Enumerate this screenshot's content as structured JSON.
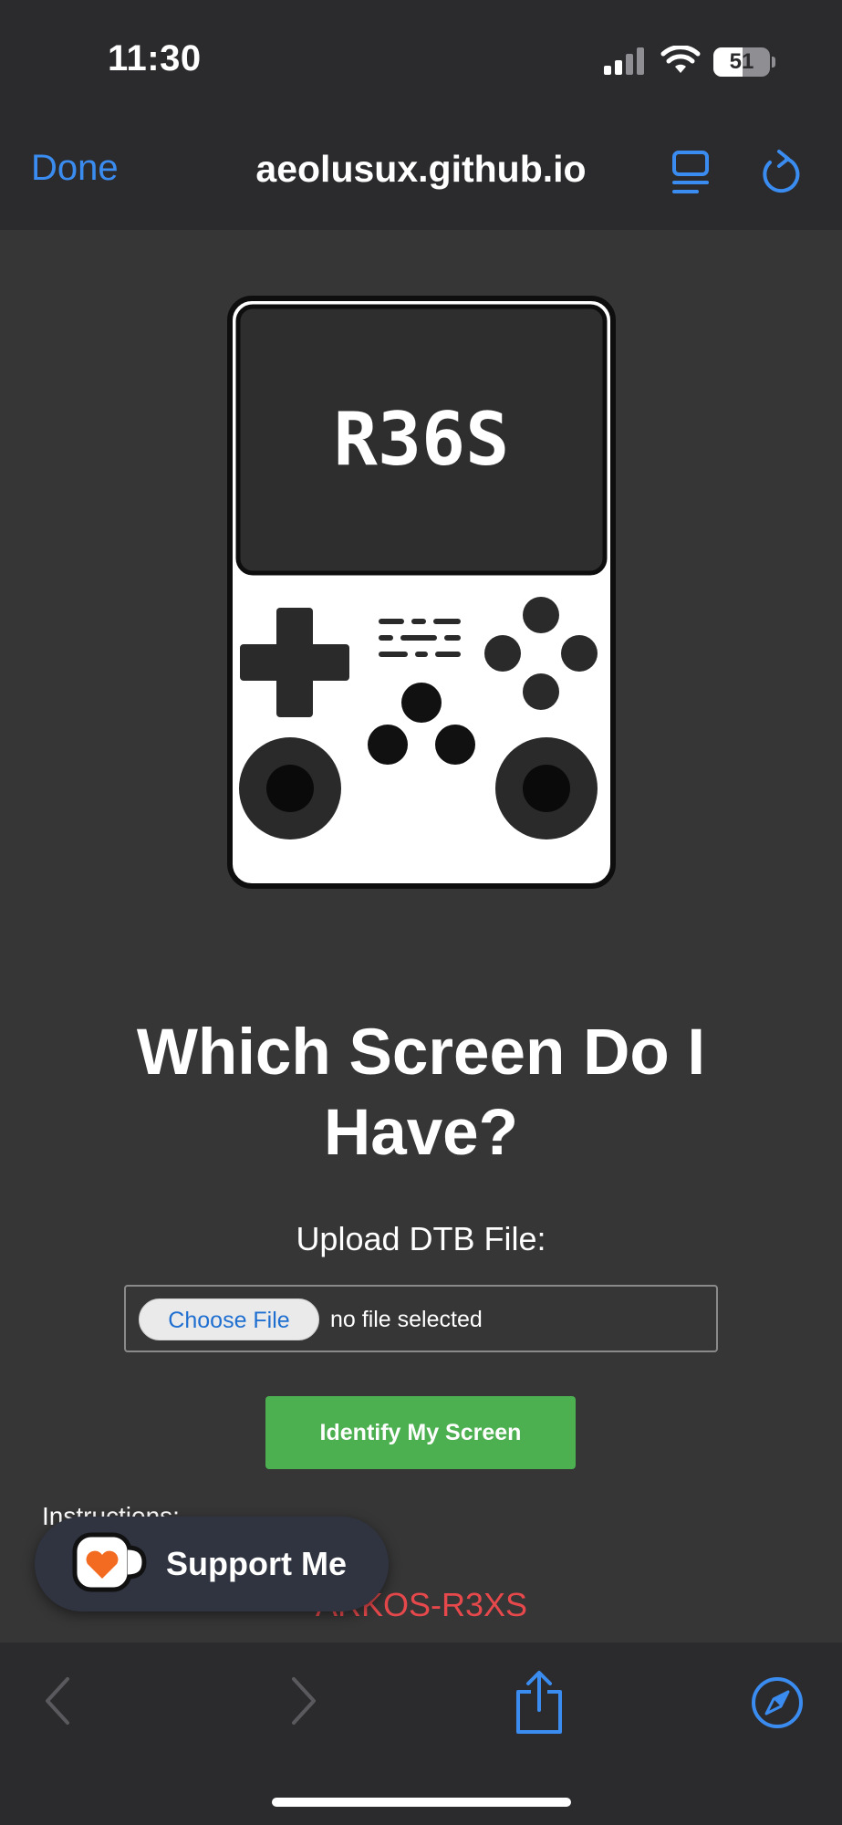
{
  "status_bar": {
    "time": "11:30",
    "battery_level": "51"
  },
  "browser": {
    "done_label": "Done",
    "url": "aeolusux.github.io"
  },
  "device_logo_text": "R36S",
  "page": {
    "heading": "Which Screen Do I Have?",
    "upload_label": "Upload DTB File:",
    "choose_file_label": "Choose File",
    "no_file_text": "no file selected",
    "identify_button_label": "Identify My Screen",
    "instructions_label": "Instructions:",
    "partial_red_text": "ARKOS-R3XS"
  },
  "support_widget": {
    "label": "Support Me"
  },
  "colors": {
    "accent_blue": "#3b8cf0",
    "button_green": "#4caf50",
    "warning_red": "#e6484b",
    "page_background": "#363636"
  },
  "icons": [
    "signal-icon",
    "wifi-icon",
    "battery-icon",
    "reader-icon",
    "reload-icon",
    "coffee-cup-icon",
    "back-arrow-icon",
    "forward-arrow-icon",
    "share-icon",
    "compass-icon"
  ]
}
